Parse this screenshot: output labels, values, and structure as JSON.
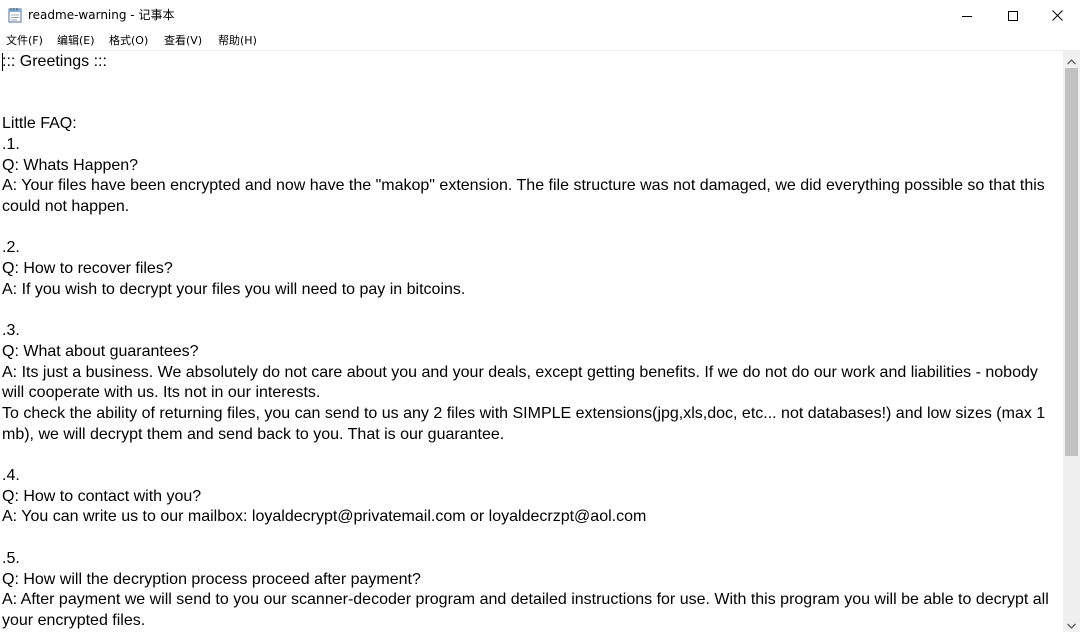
{
  "window": {
    "title": "readme-warning - 记事本"
  },
  "menu": {
    "items": [
      {
        "label": "文件(F)"
      },
      {
        "label": "编辑(E)"
      },
      {
        "label": "格式(O)"
      },
      {
        "label": "查看(V)"
      },
      {
        "label": "帮助(H)"
      }
    ]
  },
  "editor": {
    "content": "::: Greetings :::\n\n\nLittle FAQ:\n.1.\nQ: Whats Happen?\nA: Your files have been encrypted and now have the \"makop\" extension. The file structure was not damaged, we did everything possible so that this could not happen.\n\n.2.\nQ: How to recover files?\nA: If you wish to decrypt your files you will need to pay in bitcoins.\n\n.3.\nQ: What about guarantees?\nA: Its just a business. We absolutely do not care about you and your deals, except getting benefits. If we do not do our work and liabilities - nobody will cooperate with us. Its not in our interests.\nTo check the ability of returning files, you can send to us any 2 files with SIMPLE extensions(jpg,xls,doc, etc... not databases!) and low sizes (max 1 mb), we will decrypt them and send back to you. That is our guarantee.\n\n.4.\nQ: How to contact with you?\nA: You can write us to our mailbox: loyaldecrypt@privatemail.com or loyaldecrzpt@aol.com\n\n.5.\nQ: How will the decryption process proceed after payment?\nA: After payment we will send to you our scanner-decoder program and detailed instructions for use. With this program you will be able to decrypt all your encrypted files."
  },
  "icons": {
    "app": "notepad-icon",
    "minimize": "minimize-icon",
    "maximize": "maximize-icon",
    "close": "close-icon",
    "scroll_up": "scroll-up-arrow-icon",
    "scroll_down": "scroll-down-arrow-icon"
  },
  "colors": {
    "background": "#ffffff",
    "text": "#000000",
    "scroll_track": "#f0f0f0",
    "scroll_thumb": "#c1c1c1"
  }
}
